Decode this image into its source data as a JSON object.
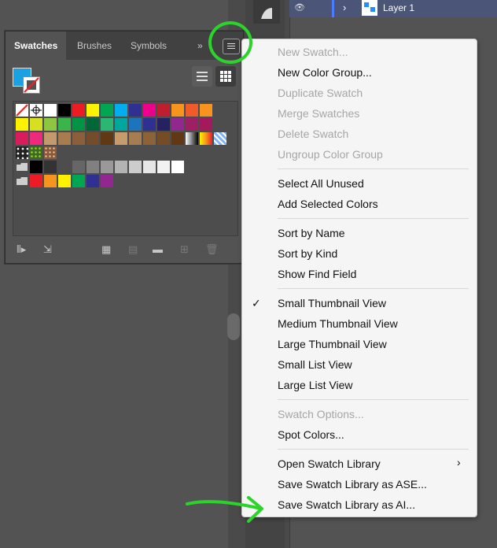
{
  "layers_panel": {
    "layer_name": "Layer 1"
  },
  "swatches_panel": {
    "tabs": [
      "Swatches",
      "Brushes",
      "Symbols"
    ],
    "overflow": "»",
    "swatch_rows": [
      [
        "none",
        "registration",
        "#ffffff",
        "#000000",
        "#ed1c24",
        "#fff200",
        "#00a651",
        "#00aeef",
        "#2e3192",
        "#ec008c",
        "#be1e2d",
        "#f7941d",
        "#f15a29",
        "#f7931e"
      ],
      [
        "#fff200",
        "#d7df23",
        "#8dc63f",
        "#39b54a",
        "#009444",
        "#006838",
        "#2bb673",
        "#00a79d",
        "#1c75bc",
        "#2e3192",
        "#262262",
        "#92278f",
        "#9e1f63",
        "#a3195b"
      ],
      [
        "#d91c5c",
        "#ed2a7b",
        "#c49a6c",
        "#a97c50",
        "#8b5e3c",
        "#754c29",
        "#603913",
        "#c69c6d",
        "#a67c52",
        "#8c6239",
        "#754c24",
        "#603813",
        "grad-bw",
        "grad-orange",
        "grad-blue"
      ],
      [
        "pattern1",
        "pattern2",
        "pattern3"
      ],
      [
        "folder",
        "#000000",
        "#333333",
        "#4d4d4d",
        "#666666",
        "#808080",
        "#999999",
        "#b3b3b3",
        "#cccccc",
        "#e6e6e6",
        "#f2f2f2",
        "#ffffff"
      ],
      [
        "folder",
        "#ed1c24",
        "#f7941d",
        "#fff200",
        "#00a651",
        "#2e3192",
        "#92278f"
      ]
    ]
  },
  "menu": {
    "items": [
      {
        "label": "New Swatch...",
        "disabled": true
      },
      {
        "label": "New Color Group...",
        "disabled": false
      },
      {
        "label": "Duplicate Swatch",
        "disabled": true
      },
      {
        "label": "Merge Swatches",
        "disabled": true
      },
      {
        "label": "Delete Swatch",
        "disabled": true
      },
      {
        "label": "Ungroup Color Group",
        "disabled": true
      },
      {
        "label": "Select All Unused",
        "disabled": false
      },
      {
        "label": "Add Selected Colors",
        "disabled": false
      },
      {
        "label": "Sort by Name",
        "disabled": false
      },
      {
        "label": "Sort by Kind",
        "disabled": false
      },
      {
        "label": "Show Find Field",
        "disabled": false
      },
      {
        "label": "Small Thumbnail View",
        "disabled": false,
        "checked": true
      },
      {
        "label": "Medium Thumbnail View",
        "disabled": false
      },
      {
        "label": "Large Thumbnail View",
        "disabled": false
      },
      {
        "label": "Small List View",
        "disabled": false
      },
      {
        "label": "Large List View",
        "disabled": false
      },
      {
        "label": "Swatch Options...",
        "disabled": true
      },
      {
        "label": "Spot Colors...",
        "disabled": false
      },
      {
        "label": "Open Swatch Library",
        "disabled": false,
        "submenu": true
      },
      {
        "label": "Save Swatch Library as ASE...",
        "disabled": false
      },
      {
        "label": "Save Swatch Library as AI...",
        "disabled": false
      }
    ],
    "checkmark": "✓",
    "submenu_arrow": "›"
  },
  "annotation_color": "#2bd32b",
  "menu_bg": "#f5f5f5",
  "panel_bg": "#535353"
}
